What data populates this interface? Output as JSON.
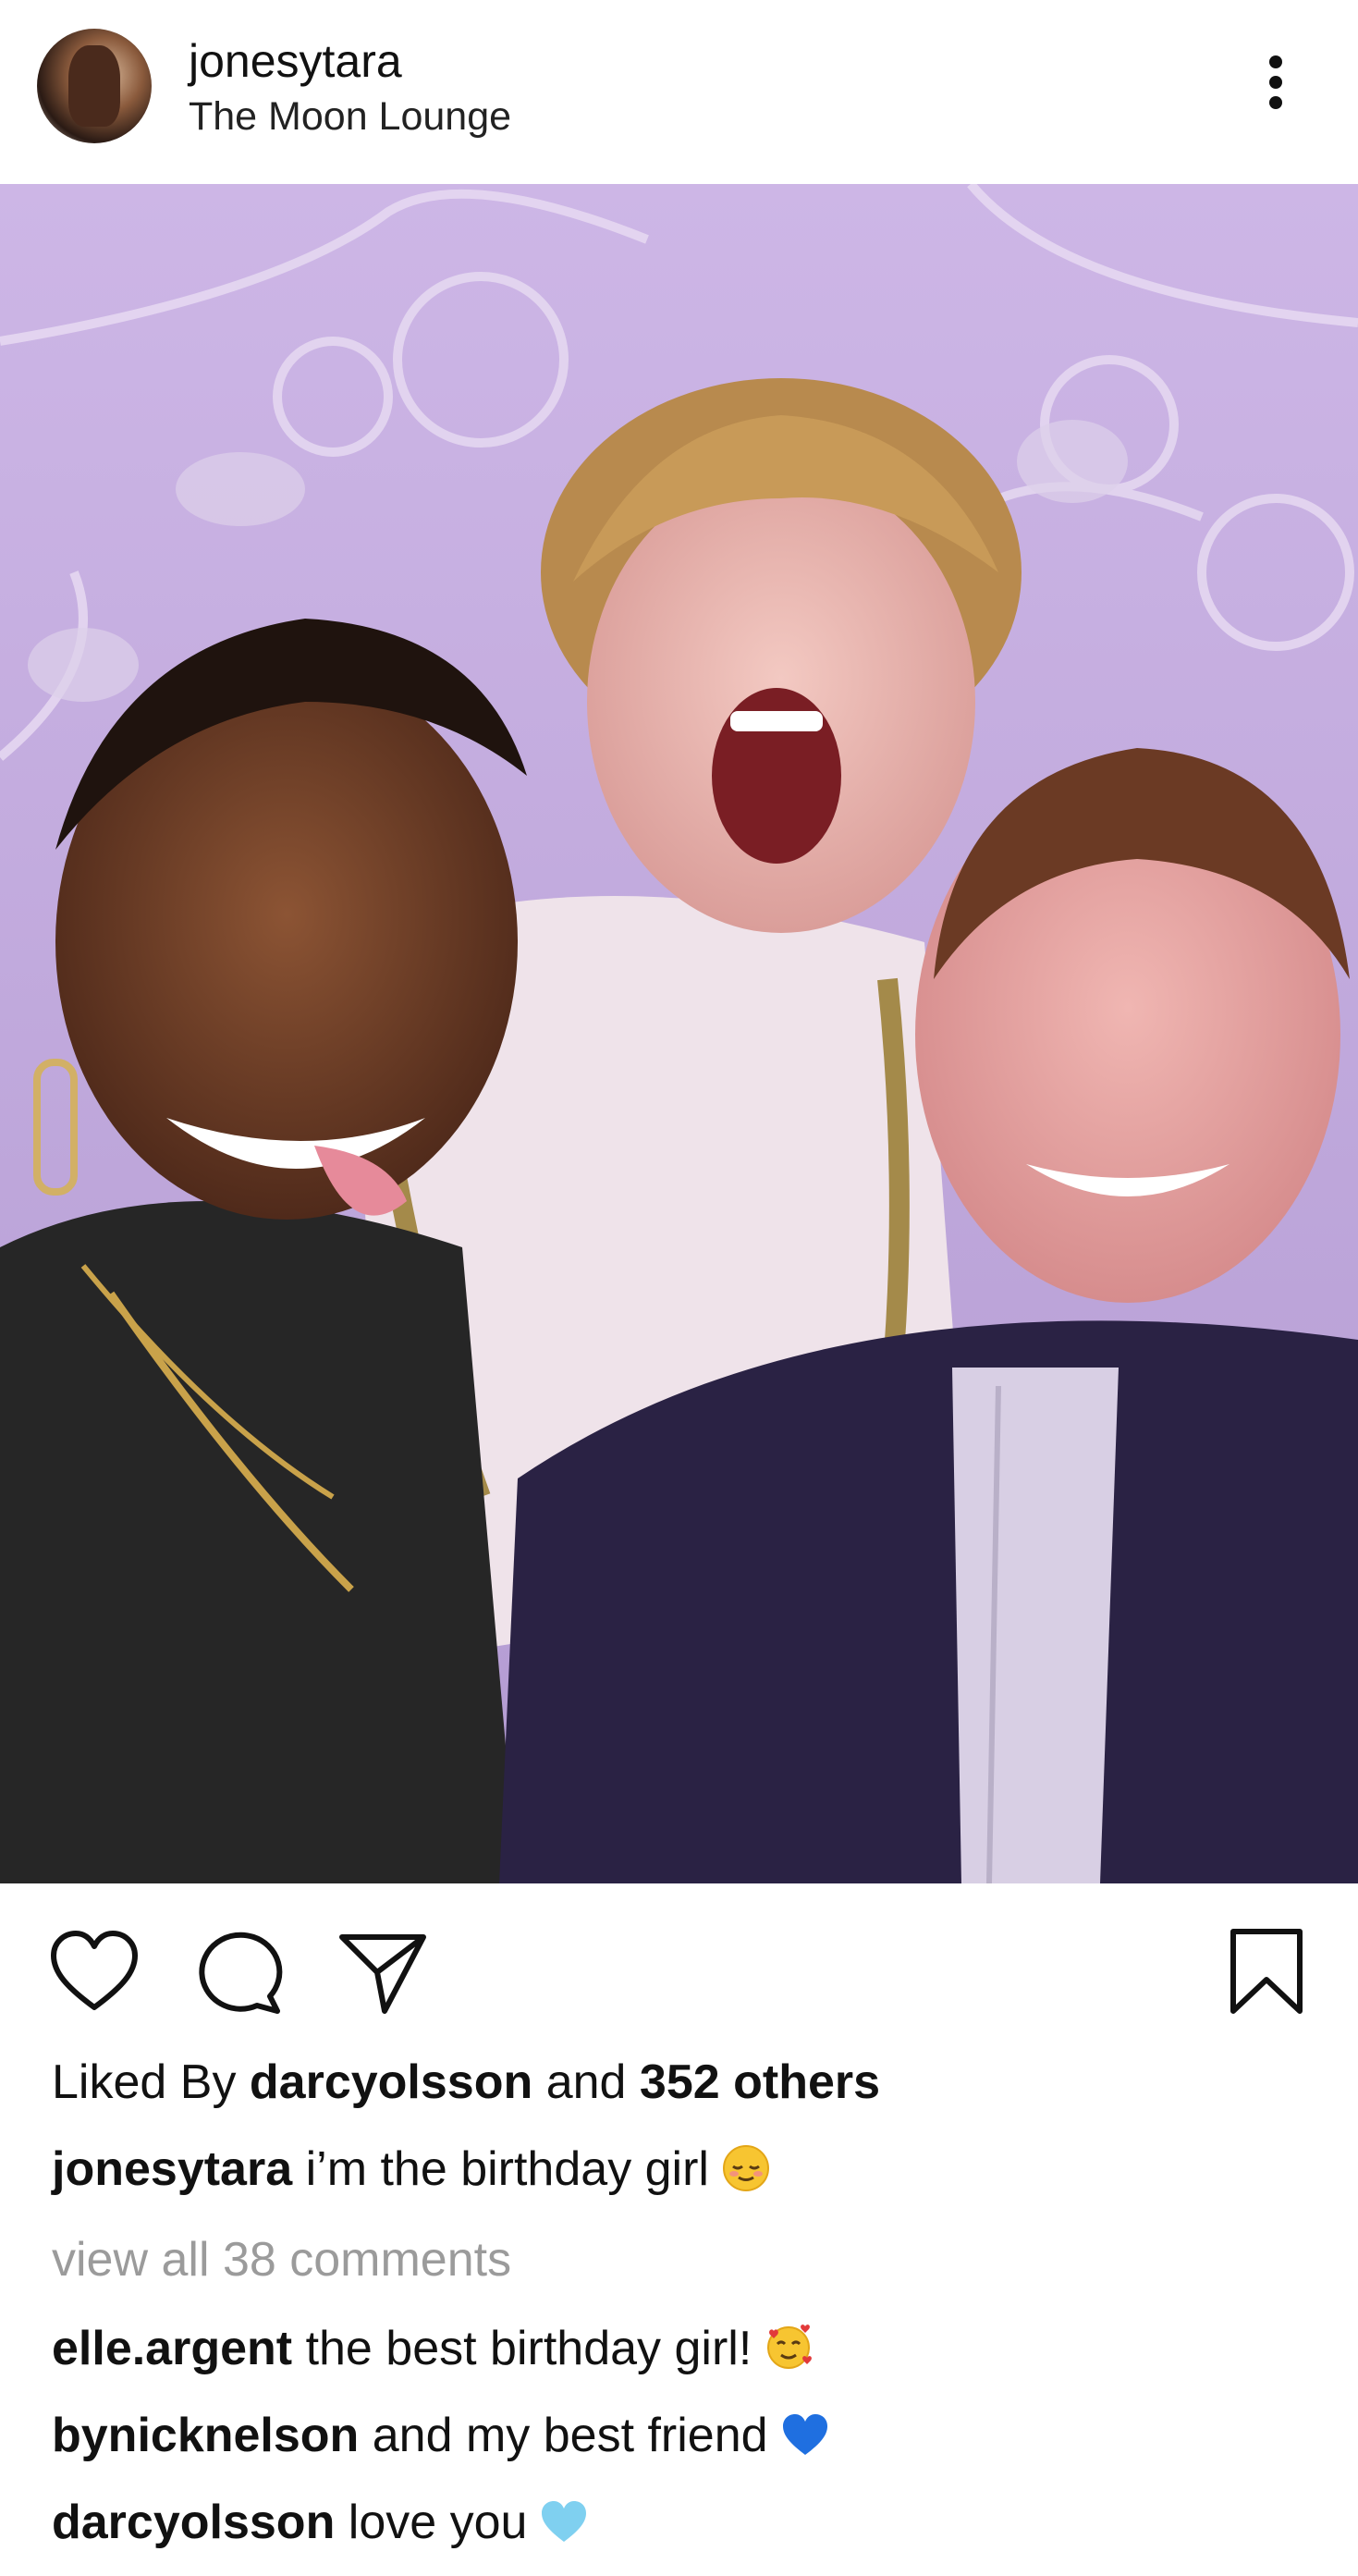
{
  "post": {
    "username": "jonesytara",
    "location": "The Moon Lounge"
  },
  "likes": {
    "prefix": "Liked By",
    "liker": "darcyolsson",
    "conjunction": "and",
    "others": "352 others"
  },
  "caption": {
    "username": "jonesytara",
    "text": "i’m the birthday girl",
    "emoji": "relieved-face-emoji"
  },
  "view_comments": "view all 38 comments",
  "comments": [
    {
      "username": "elle.argent",
      "text": "the best birthday girl!",
      "emoji": "smiling-face-with-hearts-emoji"
    },
    {
      "username": "bynicknelson",
      "text": "and my best friend",
      "emoji": "blue-heart-emoji"
    },
    {
      "username": "darcyolsson",
      "text": "love you",
      "emoji": "light-blue-heart-emoji"
    }
  ],
  "icons": {
    "more": "more-vertical-icon",
    "like": "heart-icon",
    "comment": "comment-icon",
    "share": "send-icon",
    "save": "bookmark-icon"
  },
  "colors": {
    "text": "#111111",
    "muted": "#9b9b9b",
    "blue_heart": "#1f6fe0",
    "light_blue_heart": "#7fd0f0"
  }
}
